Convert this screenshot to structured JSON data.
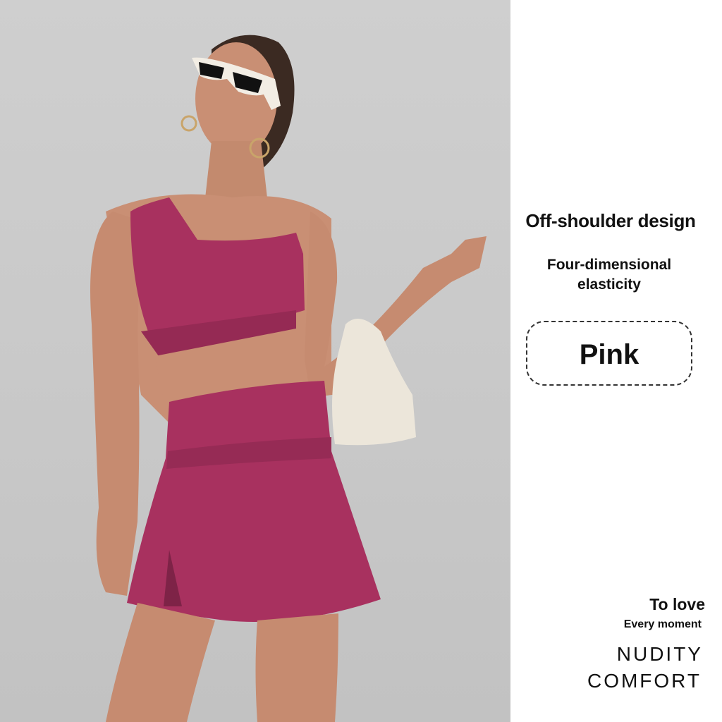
{
  "product": {
    "photo_alt": "Model wearing one-shoulder sports bra and skirt set in pink, holding a white handbag",
    "feature_primary": "Off-shoulder design",
    "feature_secondary": "Four-dimensional\nelasticity",
    "color_label": "Pink",
    "tagline_1": "To love",
    "tagline_2": "Every moment",
    "slogan_1": "NUDITY",
    "slogan_2": "COMFORT"
  },
  "colors": {
    "garment": "#a8315f",
    "background_photo": "#c9c9c9",
    "panel": "#ffffff",
    "text": "#111111"
  }
}
